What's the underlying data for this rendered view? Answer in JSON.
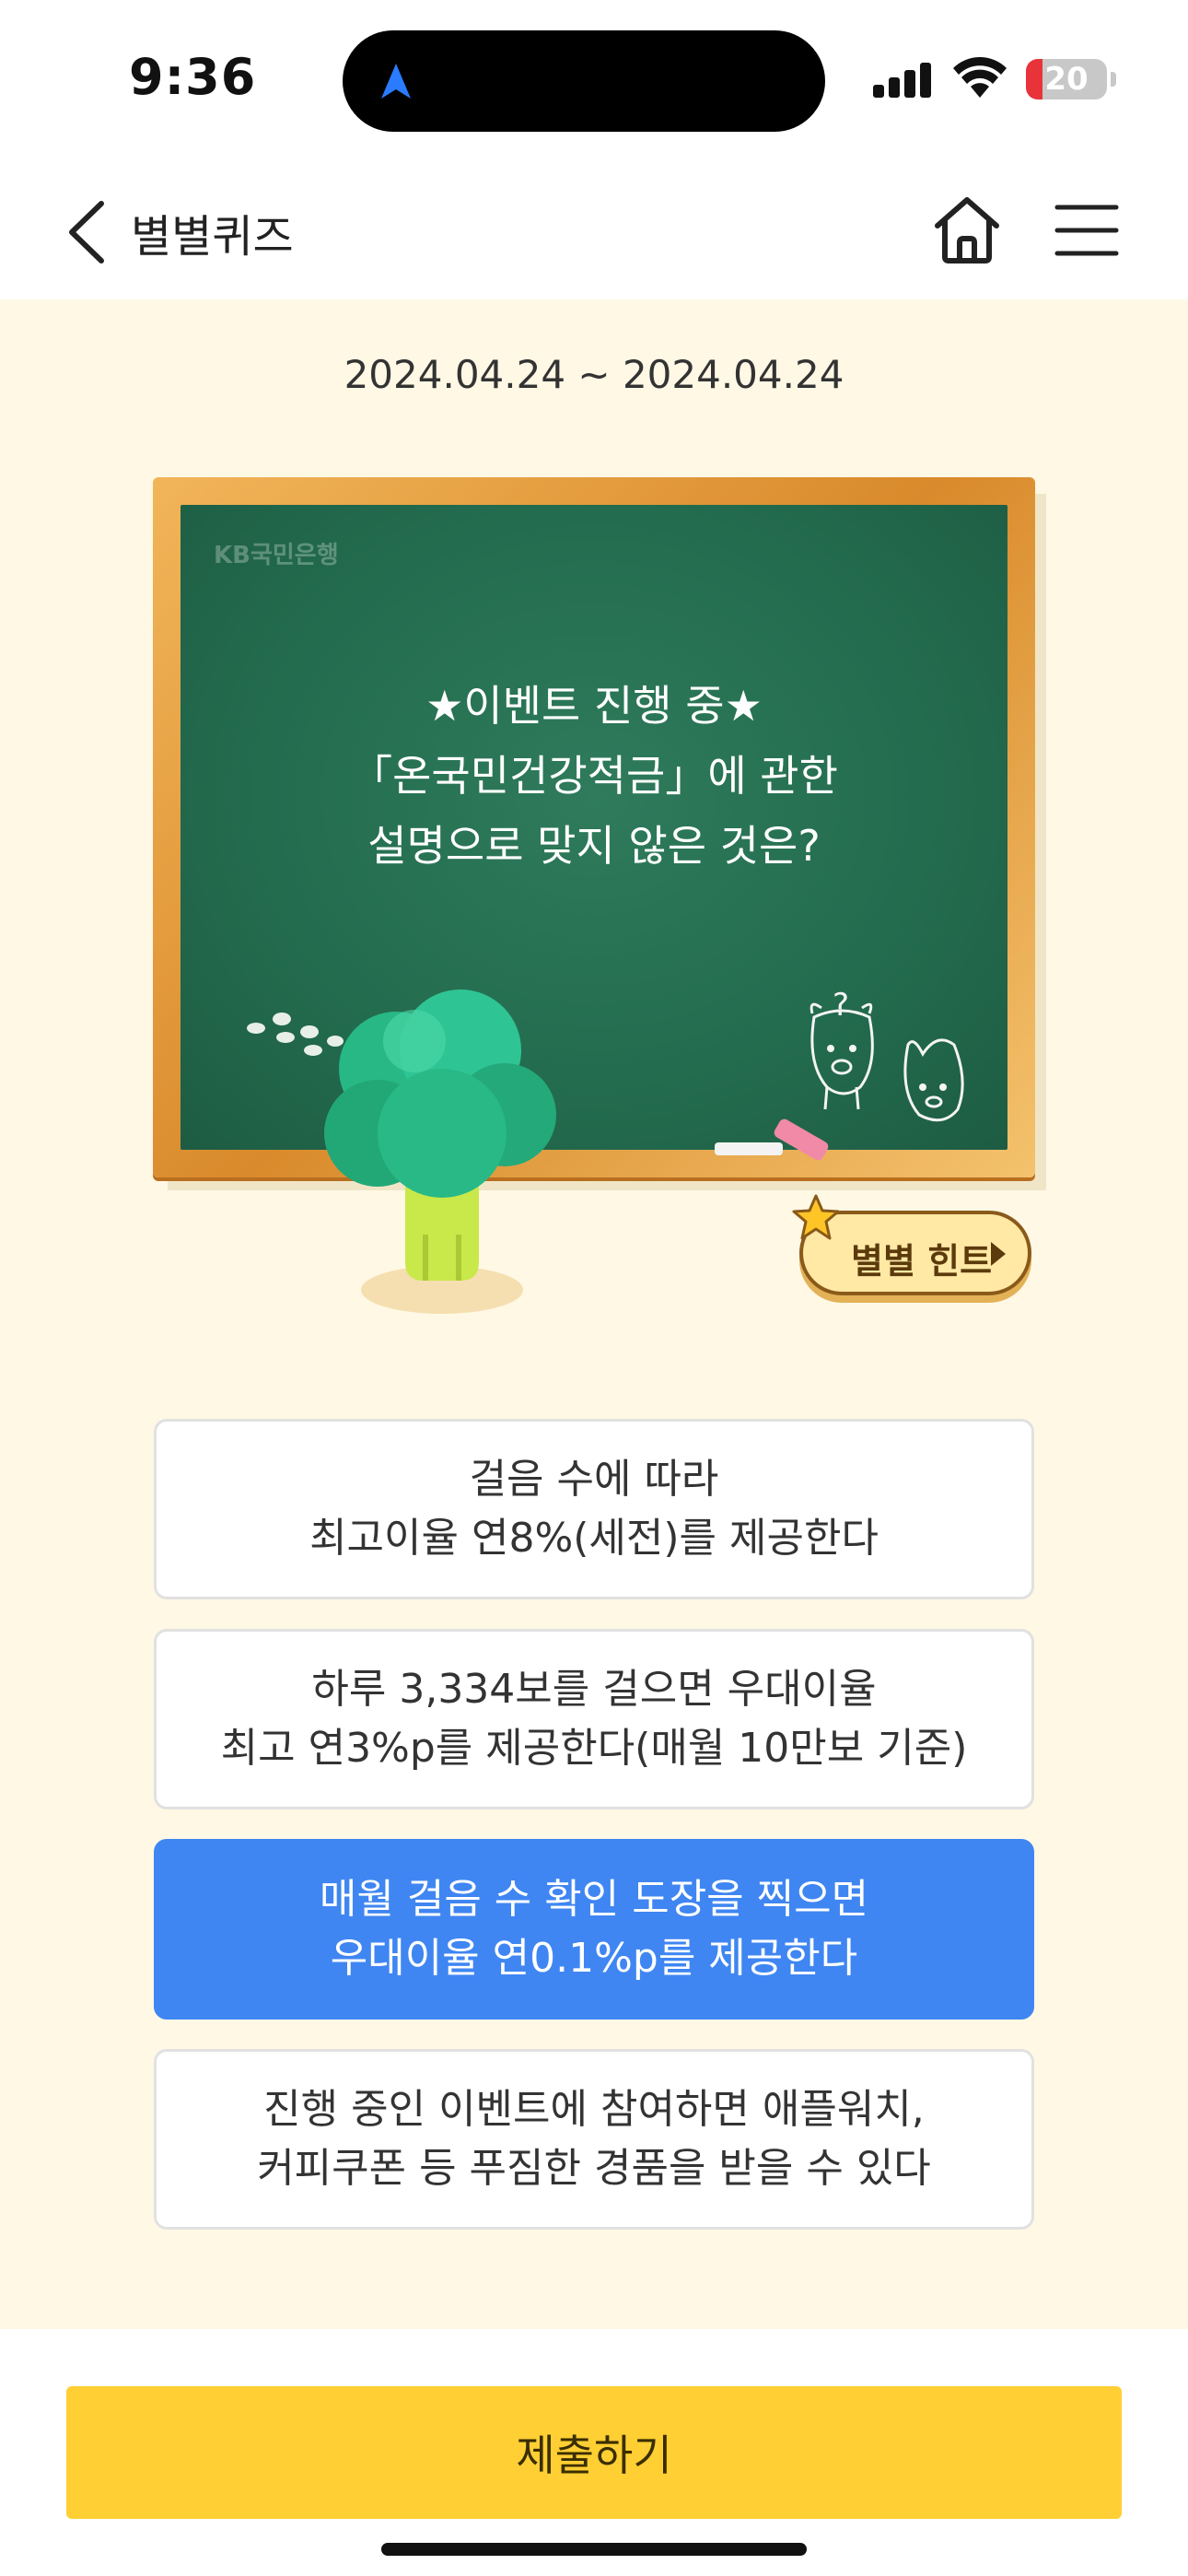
{
  "status_bar": {
    "time": "9:36",
    "battery_level": 20,
    "battery_level_text": "20",
    "icons": [
      "navigation-arrow-icon",
      "cellular-signal-icon",
      "wifi-icon",
      "battery-icon"
    ]
  },
  "header": {
    "title": "별별퀴즈",
    "icons": [
      "back-chevron-icon",
      "home-icon",
      "hamburger-menu-icon"
    ]
  },
  "content": {
    "date_range": "2024.04.24 ~ 2024.04.24",
    "board": {
      "logo": "KB국민은행",
      "question_lines": [
        "★이벤트 진행 중★",
        "「온국민건강적금」에 관한",
        "설명으로 맞지 않은 것은?"
      ]
    },
    "hint_label": "별별 힌트"
  },
  "options": [
    {
      "lines": [
        "걸음 수에 따라",
        "최고이율 연8%(세전)를 제공한다"
      ],
      "selected": false
    },
    {
      "lines": [
        "하루 3,334보를 걸으면 우대이율",
        "최고 연3%p를 제공한다(매월 10만보 기준)"
      ],
      "selected": false
    },
    {
      "lines": [
        "매월 걸음 수 확인 도장을 찍으면",
        "우대이율 연0.1%p를 제공한다"
      ],
      "selected": true
    },
    {
      "lines": [
        "진행 중인 이벤트에 참여하면 애플워치,",
        "커피쿠폰 등 푸짐한 경품을 받을 수 있다"
      ],
      "selected": false
    }
  ],
  "submit_label": "제출하기",
  "colors": {
    "background": "#fff8e5",
    "selected_option": "#3f86f2",
    "submit_button": "#ffcf33",
    "chalkboard": "#236b4e",
    "board_frame": "#e09a3e"
  }
}
